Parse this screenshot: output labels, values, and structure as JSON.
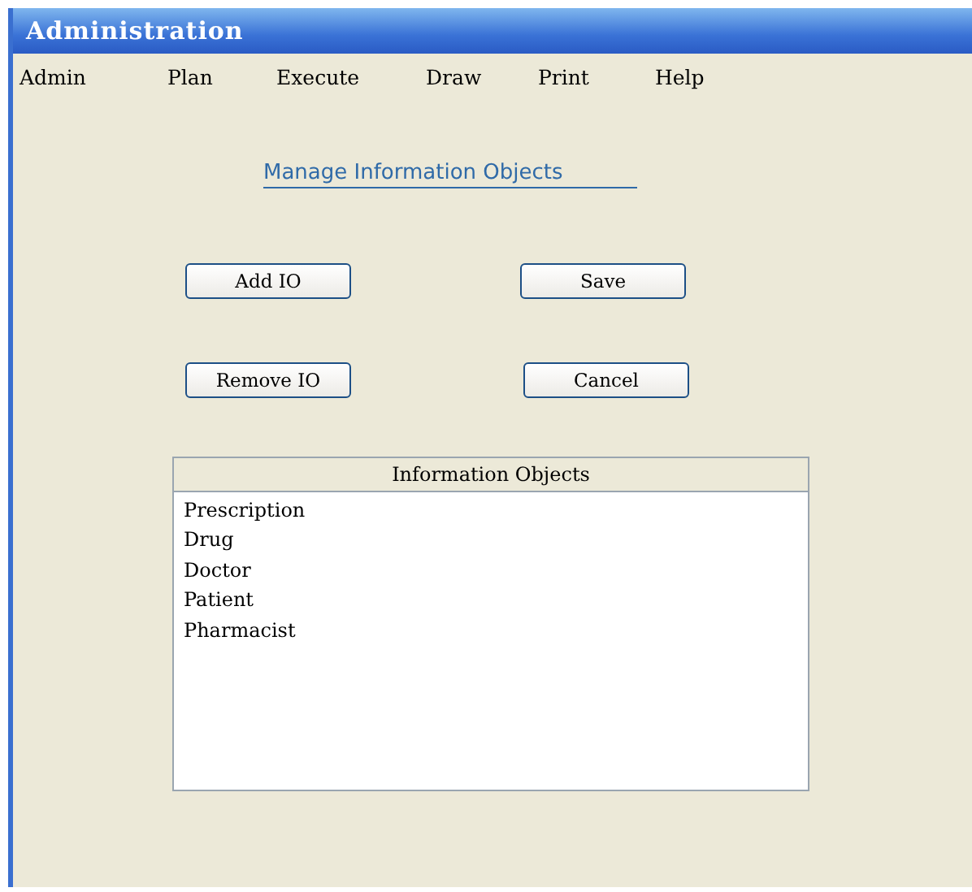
{
  "window": {
    "title": "Administration"
  },
  "menu": [
    "Admin",
    "Plan",
    "Execute",
    "Draw",
    "Print",
    "Help"
  ],
  "heading": "Manage Information Objects",
  "buttons": [
    {
      "label": "Add IO"
    },
    {
      "label": "Save"
    },
    {
      "label": "Remove IO"
    },
    {
      "label": "Cancel"
    }
  ],
  "list": {
    "header": "Information Objects",
    "items": [
      "Prescription",
      "Drug",
      "Doctor",
      "Patient",
      "Pharmacist"
    ]
  }
}
